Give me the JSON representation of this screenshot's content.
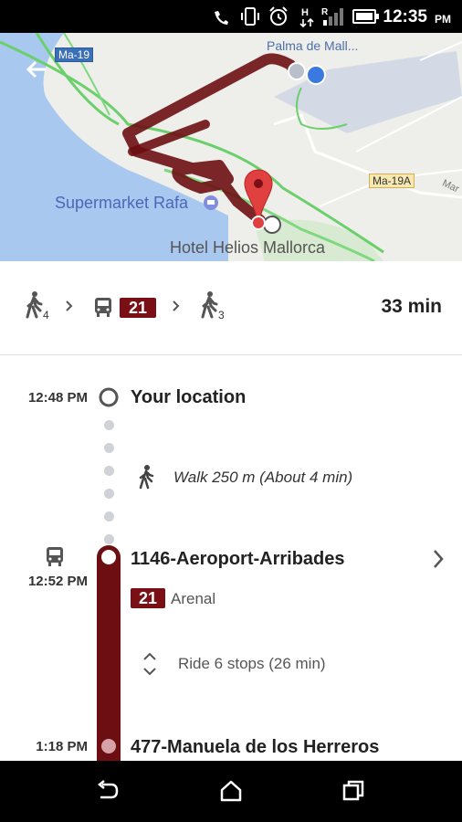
{
  "status_bar": {
    "time": "12:35",
    "ampm": "PM"
  },
  "map": {
    "labels": {
      "palma": "Palma de Mall...",
      "supermarket": "Supermarket Rafa",
      "hotel": "Hotel Helios Mallorca",
      "ma19": "Ma-19",
      "ma19a": "Ma-19A",
      "mar": "Mar"
    }
  },
  "summary": {
    "walk_before_minutes": "4",
    "route_number": "21",
    "walk_after_minutes": "3",
    "duration": "33 min"
  },
  "timeline": {
    "start": {
      "time": "12:48 PM",
      "name": "Your location"
    },
    "walk": {
      "text": "Walk 250 m (About 4 min)"
    },
    "board": {
      "time": "12:52 PM",
      "name": "1146-Aeroport-Arribades",
      "route": "21",
      "headsign": "Arenal"
    },
    "ride": {
      "text": "Ride 6 stops (26 min)"
    },
    "alight": {
      "time": "1:18 PM",
      "name": "477-Manuela de los Herreros"
    }
  },
  "colors": {
    "route": "#6d0e12",
    "route_badge": "#7a1016",
    "map_water": "#a9c8ef",
    "map_land": "#eeeeea"
  }
}
